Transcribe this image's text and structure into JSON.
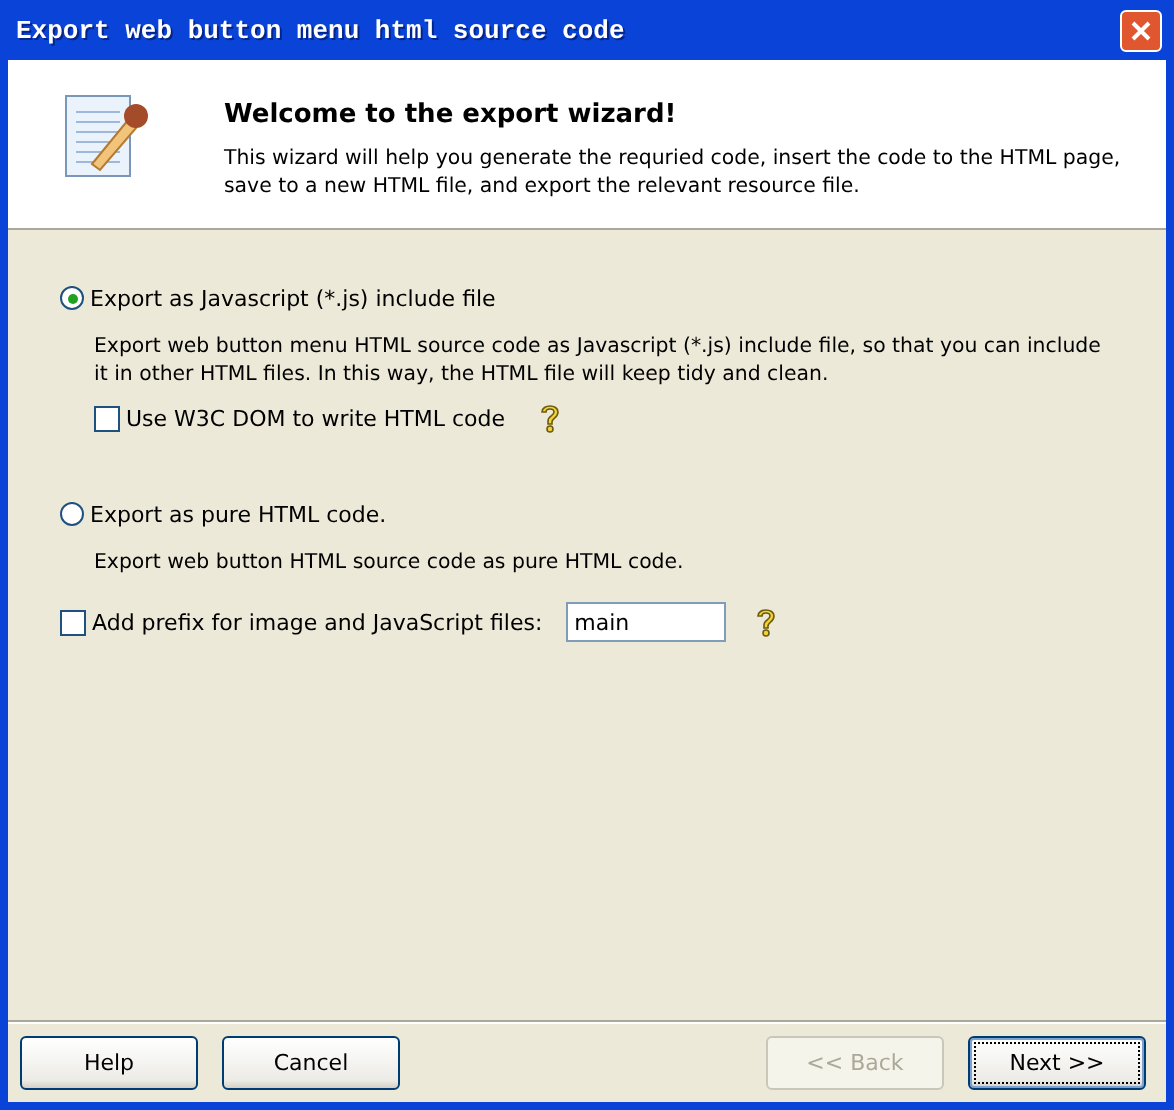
{
  "window": {
    "title": "Export web button menu html source code"
  },
  "header": {
    "title": "Welcome to the export wizard!",
    "description": "This wizard will help you generate the requried code, insert the code to the HTML page, save to a new HTML file, and export the relevant resource file."
  },
  "export_modes": [
    {
      "label": "Export as Javascript (*.js) include file",
      "selected": true,
      "description": "Export web button menu HTML source code as Javascript (*.js) include file, so that you can include it in other HTML files. In this way, the HTML file will keep tidy and clean.",
      "options": [
        {
          "label": "Use W3C DOM to write HTML code",
          "checked": false
        }
      ]
    },
    {
      "label": "Export as pure HTML code.",
      "selected": false,
      "description": "Export web button HTML source code as pure HTML code."
    }
  ],
  "prefix": {
    "label": "Add prefix for image and JavaScript files:",
    "checked": false,
    "value": "main"
  },
  "buttons": [
    {
      "label": "Help",
      "disabled": false,
      "default": false
    },
    {
      "label": "Cancel",
      "disabled": false,
      "default": false
    },
    {
      "label": "<< Back",
      "disabled": true,
      "default": false
    },
    {
      "label": "Next >>",
      "disabled": false,
      "default": true
    }
  ]
}
